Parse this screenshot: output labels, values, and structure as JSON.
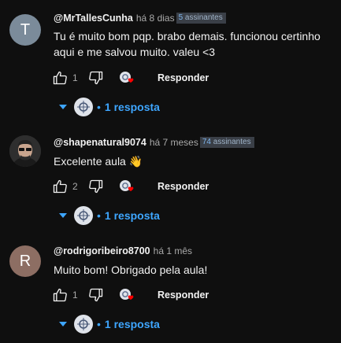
{
  "comments": [
    {
      "avatar_letter": "T",
      "avatar_color": "#7b8b9a",
      "author": "@MrTallesCunha",
      "time": "há 8 dias",
      "badge_num": "5",
      "badge_text": "assinantes",
      "text": "Tu é muito bom pqp. brabo demais. funcionou certinho aqui e me salvou muito. valeu <3",
      "likes": "1",
      "reply_label": "Responder",
      "replies_label": "1 resposta"
    },
    {
      "avatar_letter": "",
      "avatar_color": "#3a3a3a",
      "author": "@shapenatural9074",
      "time": "há 7 meses",
      "badge_num": "74",
      "badge_text": "assinantes",
      "text": "Excelente aula 👋",
      "likes": "2",
      "reply_label": "Responder",
      "replies_label": "1 resposta"
    },
    {
      "avatar_letter": "R",
      "avatar_color": "#8d6e63",
      "author": "@rodrigoribeiro8700",
      "time": "há 1 mês",
      "badge_num": "",
      "badge_text": "",
      "text": "Muito bom! Obrigado pela aula!",
      "likes": "1",
      "reply_label": "Responder",
      "replies_label": "1 resposta"
    }
  ],
  "icons": {
    "like": "thumb-up-icon",
    "dislike": "thumb-down-icon",
    "creator_heart": "creator-heart-icon",
    "expand": "caret-down-icon"
  },
  "colors": {
    "background": "#0f0f0f",
    "link_blue": "#3ea6ff",
    "heart_red": "#ff0000"
  }
}
